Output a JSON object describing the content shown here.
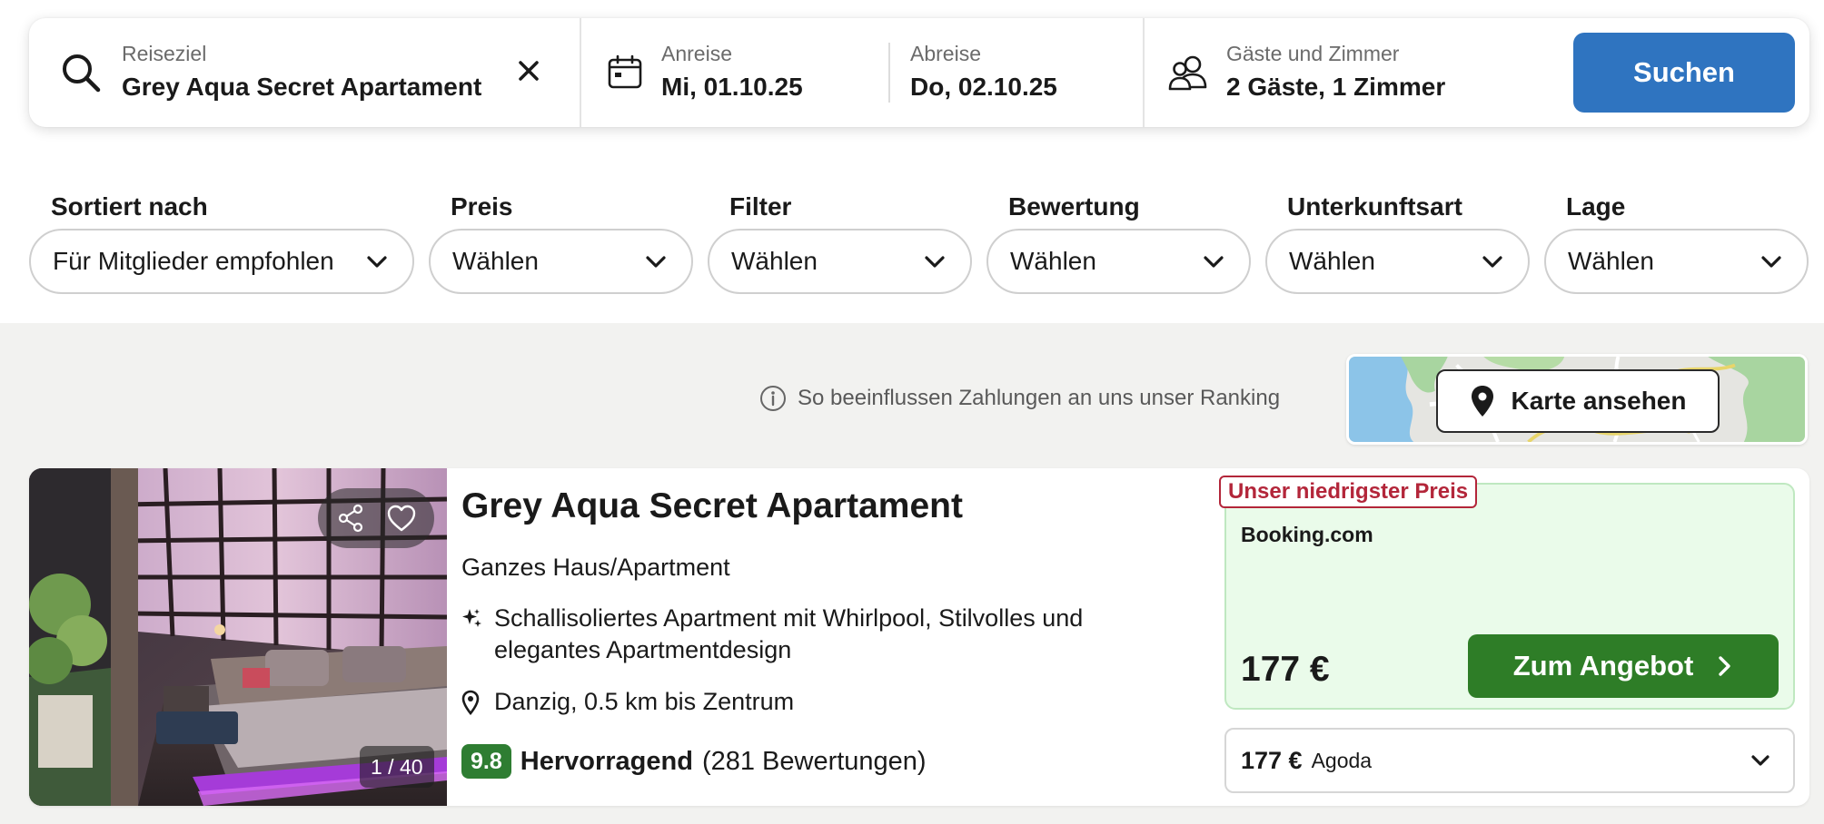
{
  "search": {
    "destination_label": "Reiseziel",
    "destination_value": "Grey Aqua Secret Apartament",
    "checkin_label": "Anreise",
    "checkin_value": "Mi, 01.10.25",
    "checkout_label": "Abreise",
    "checkout_value": "Do, 02.10.25",
    "guests_label": "Gäste und Zimmer",
    "guests_value": "2 Gäste, 1 Zimmer",
    "search_button": "Suchen"
  },
  "filters": [
    {
      "label": "Sortiert nach",
      "value": "Für Mitglieder empfohlen"
    },
    {
      "label": "Preis",
      "value": "Wählen"
    },
    {
      "label": "Filter",
      "value": "Wählen"
    },
    {
      "label": "Bewertung",
      "value": "Wählen"
    },
    {
      "label": "Unterkunftsart",
      "value": "Wählen"
    },
    {
      "label": "Lage",
      "value": "Wählen"
    }
  ],
  "ranking_note": "So beeinflussen Zahlungen an uns unser Ranking",
  "map_button": "Karte ansehen",
  "hotel": {
    "name": "Grey Aqua Secret Apartament",
    "type": "Ganzes Haus/Apartment",
    "features": "Schallisoliertes Apartment mit Whirlpool, Stilvolles und elegantes Apartmentdesign",
    "location": "Danzig, 0.5 km bis Zentrum",
    "rating_score": "9.8",
    "rating_word": "Hervorragend",
    "rating_count": "(281 Bewertungen)",
    "photo_counter": "1 / 40",
    "lowest_badge": "Unser niedrigster Preis",
    "provider": "Booking.com",
    "price": "177 €",
    "deal_button": "Zum Angebot",
    "alt_price": "177 €",
    "alt_provider": "Agoda"
  },
  "colors": {
    "primary_blue": "#2f74c0",
    "deal_green": "#2e7d27",
    "rating_green": "#2e7d32",
    "lowest_red": "#b3263a"
  }
}
